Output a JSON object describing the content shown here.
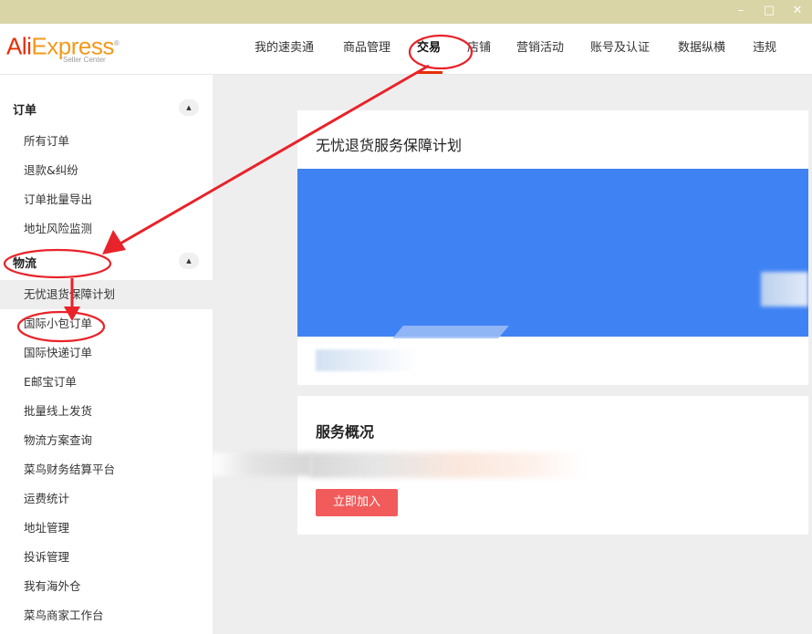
{
  "window": {
    "minimize_label": "–",
    "maximize_label": "□",
    "close_label": "✕"
  },
  "brand": {
    "logo_part1": "Ali",
    "logo_part2": "Express",
    "registered": "®",
    "subtitle": "Seller Center",
    "colors": {
      "ali": "#e62e04",
      "express": "#f39a1c"
    }
  },
  "nav": {
    "items": [
      {
        "label": "我的速卖通"
      },
      {
        "label": "商品管理"
      },
      {
        "label": "交易",
        "active": true
      },
      {
        "label": "店铺"
      },
      {
        "label": "营销活动"
      },
      {
        "label": "账号及认证"
      },
      {
        "label": "数据纵横"
      },
      {
        "label": "违规"
      }
    ]
  },
  "sidebar": {
    "sections": [
      {
        "title": "订单",
        "collapse_icon": "triangle-up-icon",
        "items": [
          "所有订单",
          "退款&纠纷",
          "订单批量导出",
          "地址风险监测"
        ]
      },
      {
        "title": "物流",
        "collapse_icon": "triangle-up-icon",
        "items": [
          "无忧退货保障计划",
          "国际小包订单",
          "国际快递订单",
          "E邮宝订单",
          "批量线上发货",
          "物流方案查询",
          "菜鸟财务结算平台",
          "运费统计",
          "地址管理",
          "投诉管理",
          "我有海外仓",
          "菜鸟商家工作台"
        ],
        "selected": "无忧退货保障计划"
      }
    ]
  },
  "main": {
    "card1": {
      "title": "无忧退货服务保障计划",
      "banner_color": "#3f82f3"
    },
    "card2": {
      "title": "服务概况",
      "join_button": "立即加入",
      "button_color": "#f25b5b"
    }
  },
  "annotations": {
    "color": "#e8232a"
  }
}
